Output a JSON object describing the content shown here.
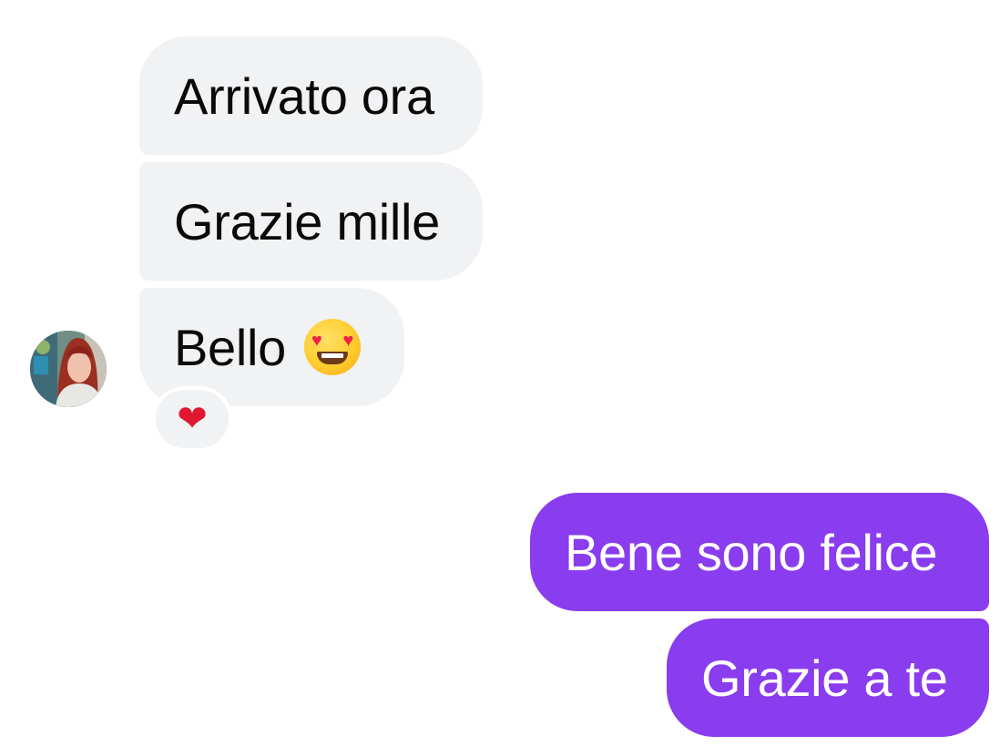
{
  "conversation": {
    "incoming": [
      {
        "text": "Arrivato ora"
      },
      {
        "text": "Grazie mille"
      },
      {
        "text": "Bello",
        "emoji": "smiling-face-with-heart-eyes"
      }
    ],
    "reaction": {
      "emoji": "red-heart",
      "glyph": "❤"
    },
    "outgoing": [
      {
        "text": "Bene sono felice"
      },
      {
        "text": "Grazie a te"
      }
    ]
  },
  "colors": {
    "incoming_bubble": "#f1f2f4",
    "outgoing_bubble": "#8a3cef",
    "incoming_text": "#0a0a0a",
    "outgoing_text": "#ffffff"
  }
}
